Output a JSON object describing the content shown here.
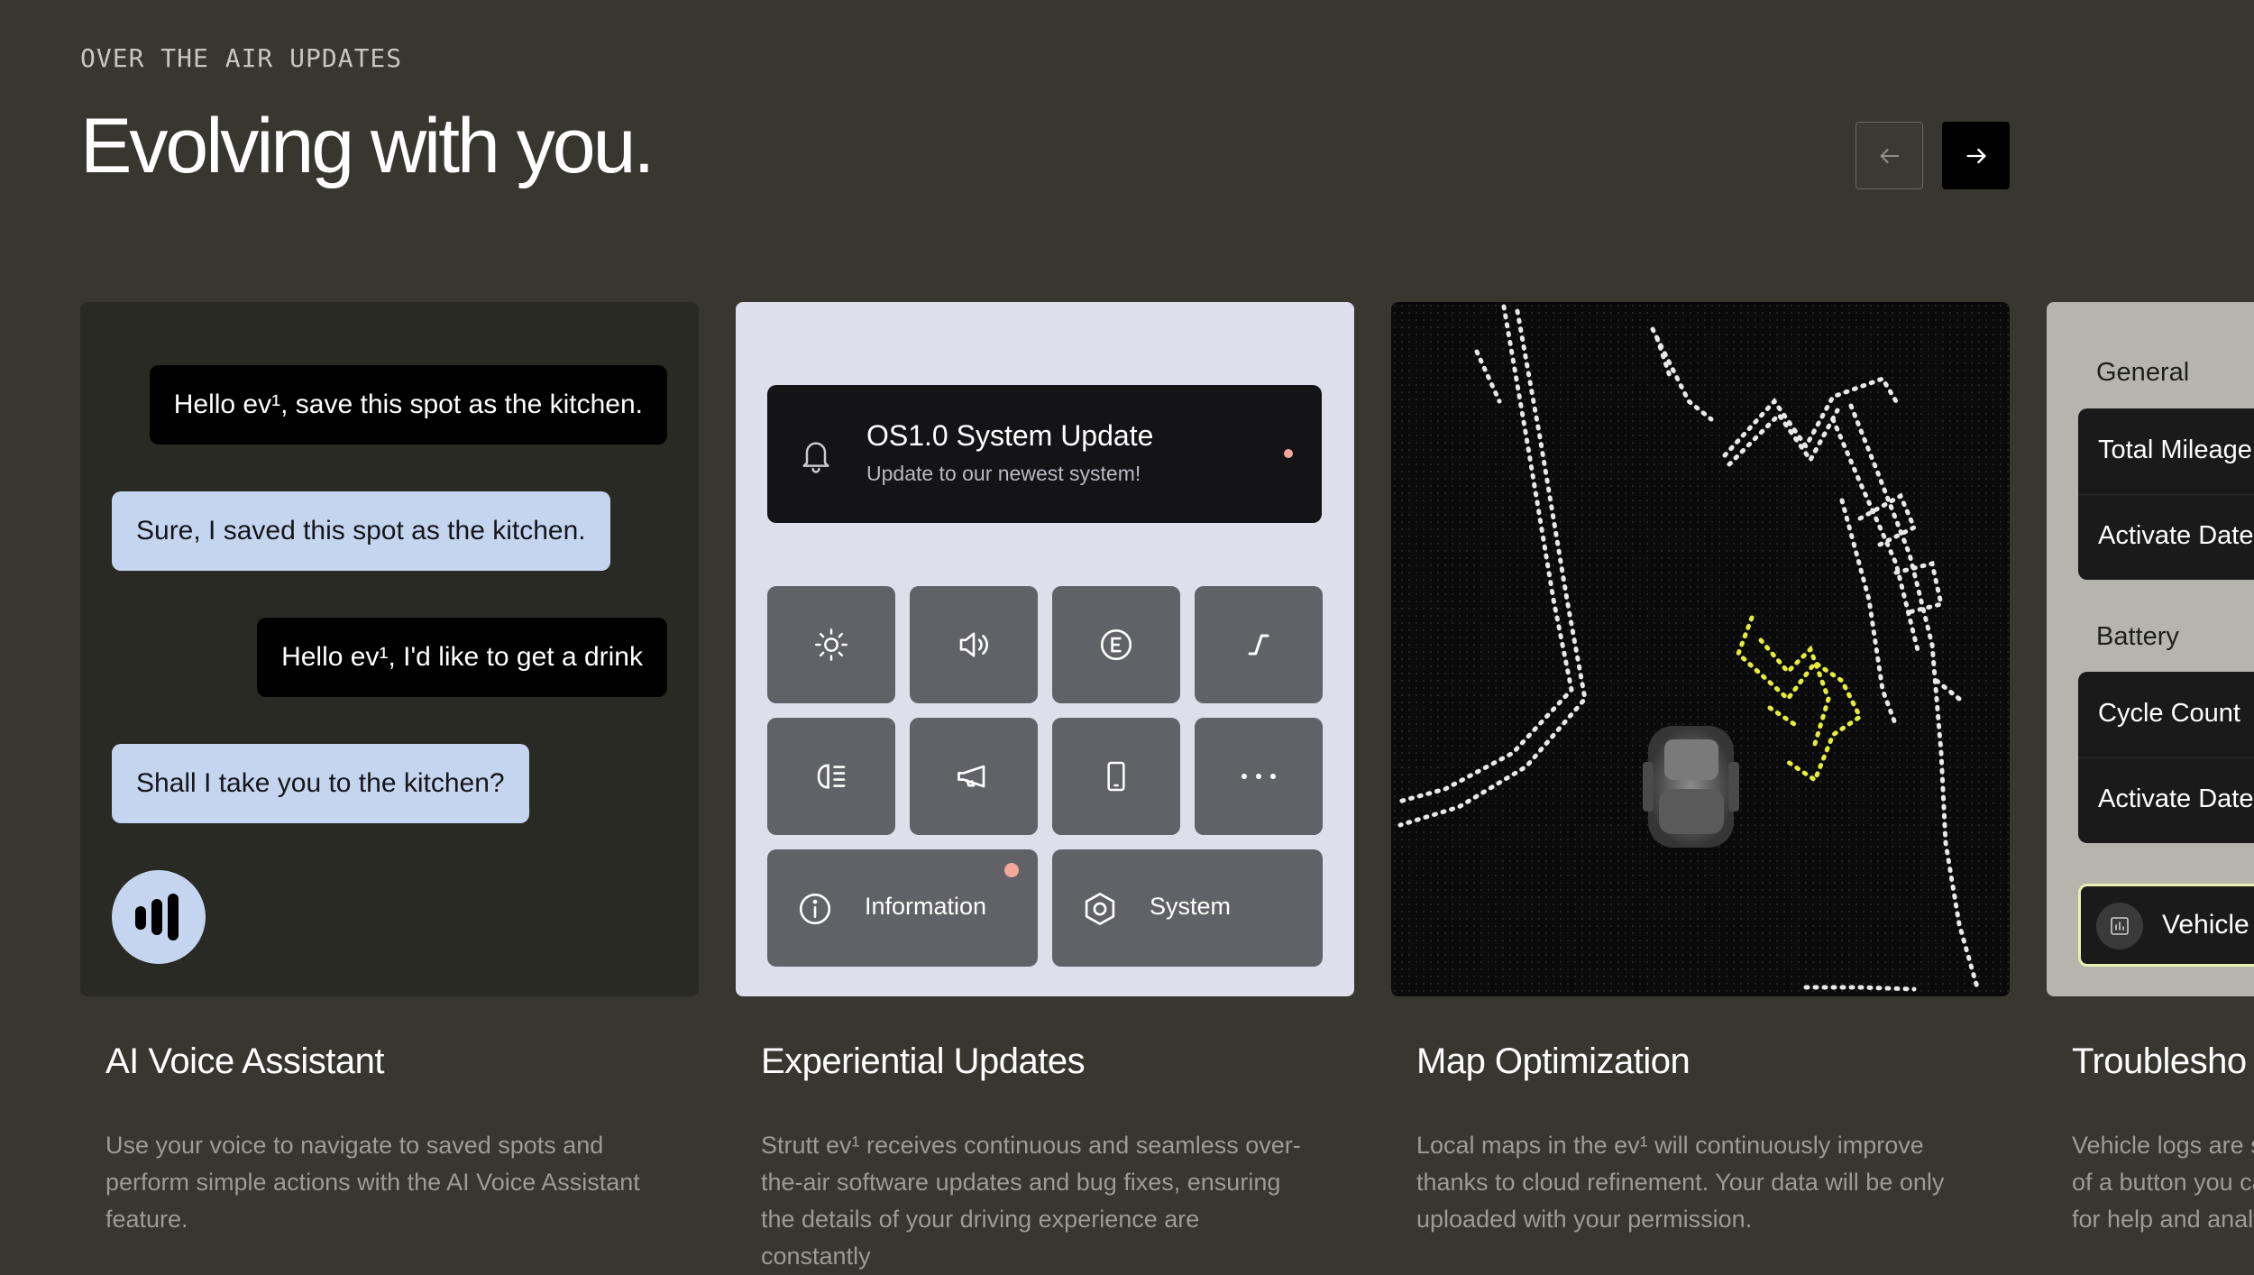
{
  "section": {
    "eyebrow": "OVER THE AIR UPDATES",
    "headline": "Evolving with you."
  },
  "carousel": {
    "prev_icon": "arrow-left-icon",
    "next_icon": "arrow-right-icon"
  },
  "cards": [
    {
      "title": "AI Voice Assistant",
      "description": "Use your voice to navigate to saved spots and perform simple actions with the AI Voice Assistant feature.",
      "chat": [
        {
          "role": "user",
          "text": "Hello ev¹, save this spot as the kitchen."
        },
        {
          "role": "assistant",
          "text": "Sure, I saved this spot as the kitchen."
        },
        {
          "role": "user",
          "text": "Hello ev¹, I'd like to get a drink"
        },
        {
          "role": "assistant",
          "text": "Shall I take you to the kitchen?"
        }
      ],
      "avatar_icon": "voice-waveform-icon"
    },
    {
      "title": "Experiential Updates",
      "description": "Strutt ev¹ receives continuous and seamless over-the-air software updates and bug fixes, ensuring the details of your driving experience are constantly",
      "notification": {
        "title": "OS1.0 System Update",
        "subtitle": "Update to our newest system!",
        "icon": "bell-icon"
      },
      "tiles": [
        "brightness-icon",
        "volume-icon",
        "eco-mode-icon",
        "ramp-icon",
        "headlight-icon",
        "horn-icon",
        "phone-icon",
        "more-icon"
      ],
      "wide_tiles": [
        {
          "label": "Information",
          "icon": "info-icon"
        },
        {
          "label": "System",
          "icon": "settings-hex-icon"
        }
      ]
    },
    {
      "title": "Map Optimization",
      "description": "Local maps in the ev¹ will continuously improve thanks to cloud refinement. Your data will be only uploaded with your permission."
    },
    {
      "title": "Troublesho",
      "description_lines": [
        "Vehicle logs are s",
        "of a button you ca",
        "for help and analy"
      ],
      "sections": [
        {
          "heading": "General",
          "rows": [
            "Total Mileage",
            "Activate Date"
          ]
        },
        {
          "heading": "Battery",
          "rows": [
            "Cycle Count",
            "Activate Date"
          ]
        }
      ],
      "vehicle_button": "Vehicle"
    }
  ],
  "colors": {
    "background": "#37362f",
    "chat_user": "#000000",
    "chat_assistant": "#c5d5f0",
    "notification_dot": "#f2a79a",
    "map_highlight": "#e5ec3c"
  }
}
